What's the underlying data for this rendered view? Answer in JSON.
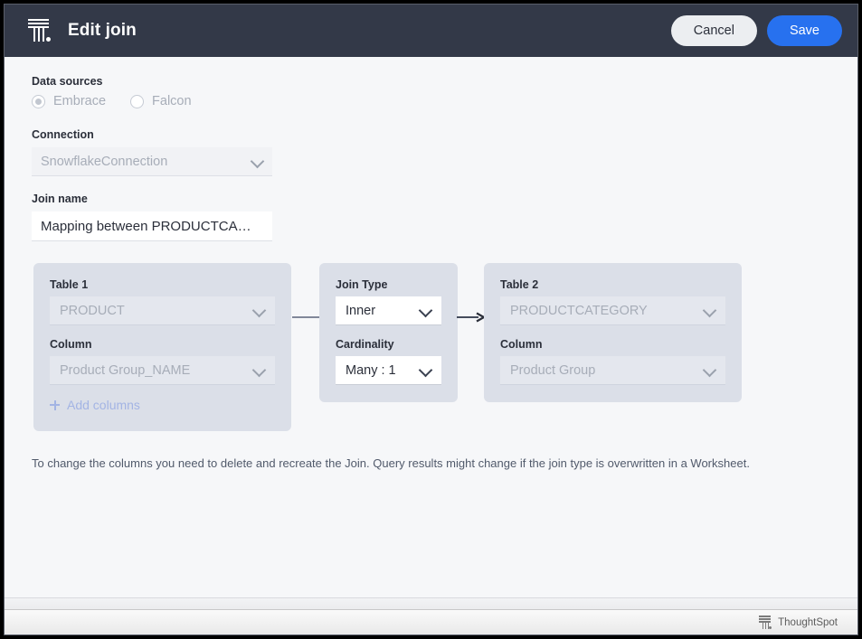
{
  "header": {
    "logo_name": "thoughtspot-logo",
    "title": "Edit join",
    "cancel_label": "Cancel",
    "save_label": "Save",
    "save_color": "#2771ef",
    "background_color": "#333948"
  },
  "form": {
    "data_sources_label": "Data sources",
    "radios": [
      {
        "label": "Embrace",
        "selected": true
      },
      {
        "label": "Falcon",
        "selected": false
      }
    ],
    "connection_label": "Connection",
    "connection_value": "SnowflakeConnection",
    "join_name_label": "Join name",
    "join_name_value": "Mapping between PRODUCTCA…"
  },
  "diagram": {
    "table1": {
      "table_label": "Table 1",
      "table_value": "PRODUCT",
      "column_label": "Column",
      "column_value": "Product Group_NAME",
      "add_columns_label": "Add columns"
    },
    "join": {
      "type_label": "Join Type",
      "type_value": "Inner",
      "cardinality_label": "Cardinality",
      "cardinality_value": "Many : 1"
    },
    "table2": {
      "table_label": "Table 2",
      "table_value": "PRODUCTCATEGORY",
      "column_label": "Column",
      "column_value": "Product Group"
    }
  },
  "note": "To change the columns you need to delete and recreate the Join. Query results might change if the join type is overwritten in a Worksheet.",
  "footer": {
    "brand": "ThoughtSpot"
  }
}
